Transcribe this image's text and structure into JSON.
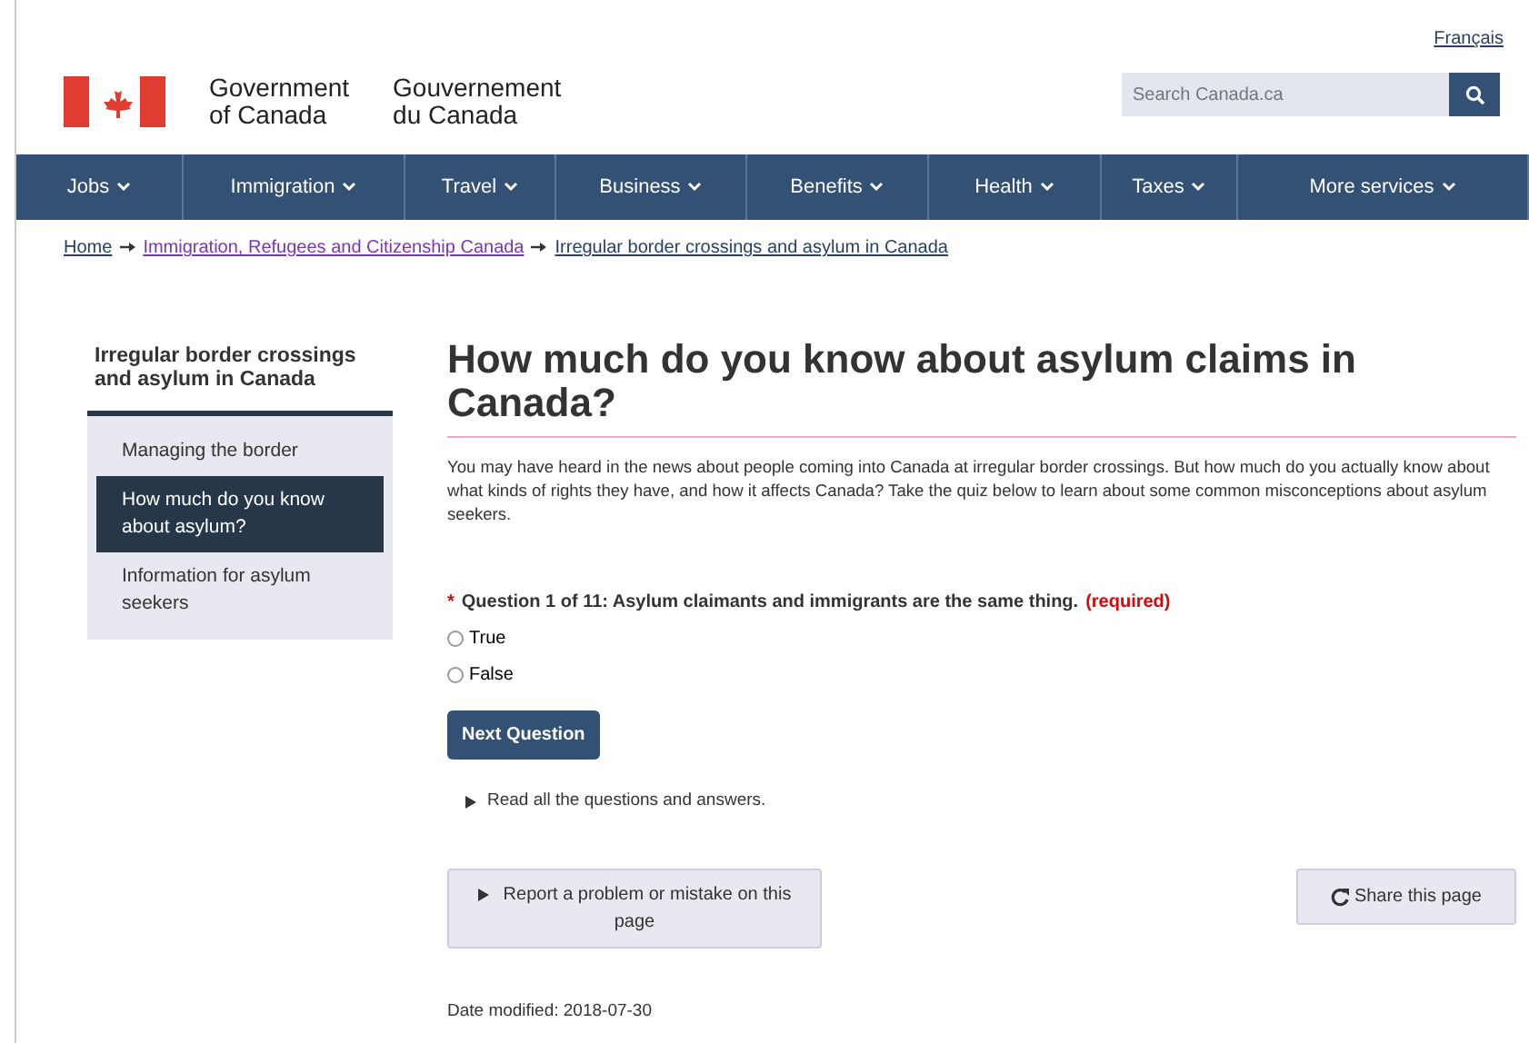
{
  "header": {
    "language_link": "Français",
    "wordmark_en": [
      "Government",
      "of Canada"
    ],
    "wordmark_fr": [
      "Gouvernement",
      "du Canada"
    ],
    "search": {
      "placeholder": "Search Canada.ca"
    }
  },
  "nav": [
    {
      "label": "Jobs"
    },
    {
      "label": "Immigration"
    },
    {
      "label": "Travel"
    },
    {
      "label": "Business"
    },
    {
      "label": "Benefits"
    },
    {
      "label": "Health"
    },
    {
      "label": "Taxes"
    },
    {
      "label": "More services"
    }
  ],
  "breadcrumb": [
    {
      "label": "Home",
      "visited": false
    },
    {
      "label": "Immigration, Refugees and Citizenship Canada",
      "visited": true
    },
    {
      "label": "Irregular border crossings and asylum in Canada",
      "visited": false
    }
  ],
  "sidebar": {
    "heading": "Irregular border crossings and asylum in Canada",
    "items": [
      {
        "label": "Managing the border",
        "selected": false
      },
      {
        "label": "How much do you know about asylum?",
        "selected": true
      },
      {
        "label": "Information for asylum seekers",
        "selected": false
      }
    ]
  },
  "main": {
    "title": "How much do you know about asylum claims in Canada?",
    "intro": "You may have heard in the news about people coming into Canada at irregular border crossings. But how much do you actually know about what kinds of rights they have, and how it affects Canada? Take the quiz below to learn about some common misconceptions about asylum seekers.",
    "question": {
      "marker": "*",
      "text": "Question 1 of 11: Asylum claimants and immigrants are the same thing.",
      "required": "(required)",
      "options": [
        {
          "label": "True",
          "selected": false
        },
        {
          "label": "False",
          "selected": false
        }
      ]
    },
    "next_button": "Next Question",
    "details_link": "Read all the questions and answers.",
    "report_button": "Report a problem or mistake on this page",
    "share_button": "Share this page",
    "date_modified": "Date modified: 2018-07-30"
  }
}
